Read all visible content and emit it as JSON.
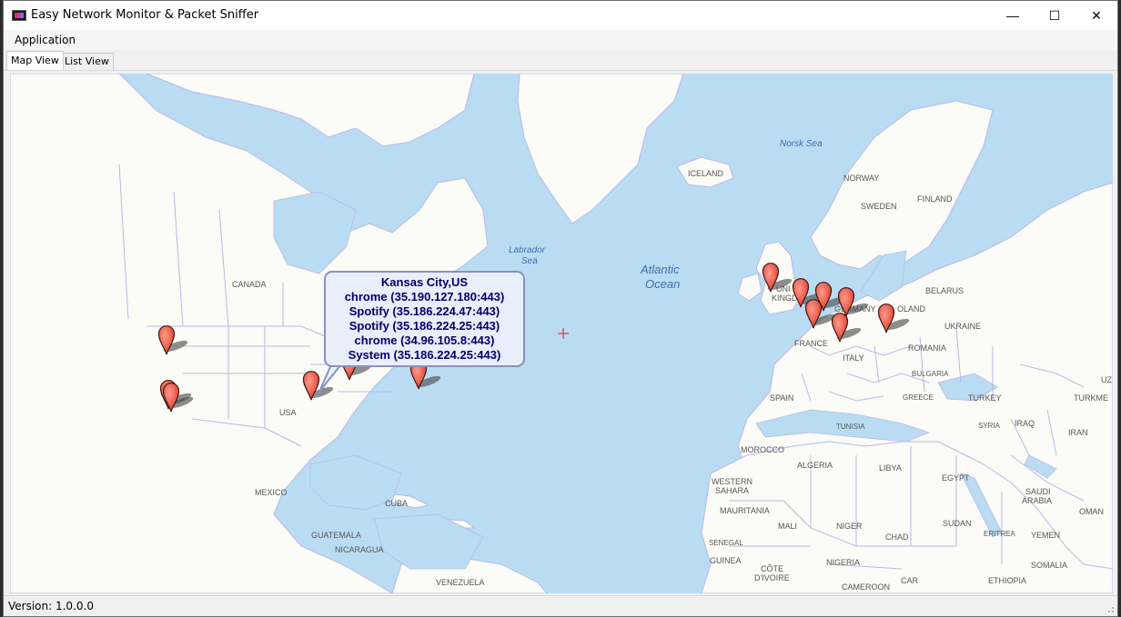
{
  "window": {
    "title": "Easy Network Monitor & Packet Sniffer",
    "controls": {
      "minimize": "—",
      "maximize": "☐",
      "close": "✕"
    }
  },
  "menu": {
    "items": [
      {
        "label": "Application"
      }
    ]
  },
  "tabs": [
    {
      "label": "Map View",
      "active": true
    },
    {
      "label": "List View",
      "active": false
    }
  ],
  "map": {
    "labels": {
      "canada": "CANADA",
      "usa": "USA",
      "mexico": "MEXICO",
      "cuba": "CUBA",
      "guatemala": "GUATEMALA",
      "nicaragua": "NICARAGUA",
      "venezuela": "VENEZUELA",
      "labrador_sea_1": "Labrador",
      "labrador_sea_2": "Sea",
      "atlantic_1": "Atlantic",
      "atlantic_2": "Ocean",
      "norsk_sea": "Norsk Sea",
      "iceland": "ICELAND",
      "norway": "NORWAY",
      "sweden": "SWEDEN",
      "finland": "FINLAND",
      "united_kingdom_1": "UNI",
      "united_kingdom_2": "KINGD",
      "belarus": "BELARUS",
      "poland": "OLAND",
      "germany": "GERMANY",
      "ukraine": "UKRAINE",
      "france": "FRANCE",
      "romania": "ROMANIA",
      "italy": "ITALY",
      "bulgaria": "BULGARIA",
      "spain": "SPAIN",
      "greece": "GREECE",
      "turkey": "TURKEY",
      "turkmenistan": "TURKME",
      "uz": "UZ",
      "tunisia": "TUNISIA",
      "syria": "SYRIA",
      "iraq": "IRAQ",
      "iran": "IRAN",
      "morocco": "MOROCCO",
      "algeria": "ALGERIA",
      "libya": "LIBYA",
      "egypt": "EGYPT",
      "western_sahara_1": "WESTERN",
      "western_sahara_2": "SAHARA",
      "mauritania": "MAURITANIA",
      "mali": "MALI",
      "niger": "NIGER",
      "chad": "CHAD",
      "sudan": "SUDAN",
      "saudi_arabia_1": "SAUDI",
      "saudi_arabia_2": "ARABIA",
      "oman": "OMAN",
      "eritrea": "ERITREA",
      "yemen": "YEMEN",
      "senegal": "SENEGAL",
      "guinea": "GUINEA",
      "cote_divoire_1": "CÔTE",
      "cote_divoire_2": "D'IVOIRE",
      "nigeria": "NIGERIA",
      "car": "CAR",
      "cameroon": "CAMEROON",
      "ethiopia": "ETHIOPIA",
      "somalia": "SOMALIA"
    },
    "tooltip": {
      "location": "Kansas City,US",
      "connections": [
        "chrome (35.190.127.180:443)",
        "Spotify (35.186.224.47:443)",
        "Spotify (35.186.224.25:443)",
        "chrome (34.96.105.8:443)",
        "System (35.186.224.25:443)"
      ]
    },
    "marker_color": "#f05a4a",
    "water_color": "#b9dcf2",
    "land_color": "#fbfbf7",
    "border_color": "#b9b9e6"
  },
  "status": {
    "version": "Version: 1.0.0.0"
  }
}
